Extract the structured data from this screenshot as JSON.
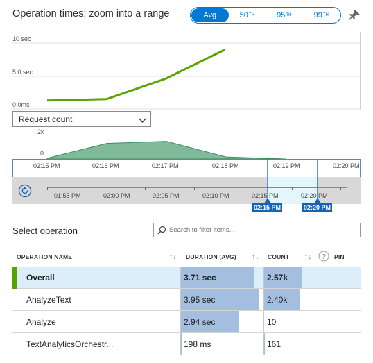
{
  "header": {
    "title": "Operation times: zoom into a range"
  },
  "percentile_toggle": {
    "options": [
      {
        "label": "Avg",
        "sup": ""
      },
      {
        "label": "50",
        "sup": "TH"
      },
      {
        "label": "95",
        "sup": "TH"
      },
      {
        "label": "99",
        "sup": "TH"
      }
    ],
    "selected": "Avg"
  },
  "duration_chart": {
    "y_ticks": [
      "10 sec",
      "5.0 sec",
      "0.0ms"
    ],
    "line_color": "#5ba300"
  },
  "metric_dropdown": {
    "value": "Request count"
  },
  "count_chart": {
    "y_ticks": [
      "2k",
      "0"
    ],
    "x_ticks": [
      "02:15 PM",
      "02:16 PM",
      "02:17 PM",
      "02:18 PM",
      "02:19 PM",
      "02:20 PM"
    ],
    "fill_color": "#7fba99"
  },
  "brush": {
    "x_ticks": [
      "01:55 PM",
      "02:00 PM",
      "02:05 PM",
      "02:10 PM",
      "02:15 PM",
      "02:20 PM"
    ],
    "handle_start": "02:15 PM",
    "handle_end": "02:20 PM"
  },
  "chart_data": [
    {
      "type": "line",
      "x": [
        "02:15 PM",
        "02:16 PM",
        "02:17 PM",
        "02:18 PM"
      ],
      "series": [
        {
          "values": [
            1.3,
            1.5,
            4.6,
            9.0
          ]
        }
      ],
      "ylim": [
        0,
        10
      ],
      "xlabel": "",
      "ylabel": ""
    },
    {
      "type": "area",
      "x": [
        "02:15 PM",
        "02:16 PM",
        "02:17 PM",
        "02:18 PM",
        "02:19 PM"
      ],
      "series": [
        {
          "values": [
            0.05,
            1.15,
            1.3,
            0.15,
            0.0
          ]
        }
      ],
      "ylim": [
        0,
        2
      ],
      "xlabel": "",
      "ylabel": ""
    }
  ],
  "select_operation": {
    "label": "Select operation",
    "search_placeholder": "Search to filter items..."
  },
  "table": {
    "headers": {
      "name": "OPERATION NAME",
      "duration": "DURATION (AVG)",
      "count": "COUNT",
      "pin": "PIN"
    },
    "rows": [
      {
        "name": "Overall",
        "duration": "3.71 sec",
        "duration_frac": 0.94,
        "count": "2.57k",
        "count_frac": 0.95,
        "selected": true
      },
      {
        "name": "AnalyzeText",
        "duration": "3.95 sec",
        "duration_frac": 1.0,
        "count": "2.40k",
        "count_frac": 0.89,
        "selected": false
      },
      {
        "name": "Analyze",
        "duration": "2.94 sec",
        "duration_frac": 0.74,
        "count": "10",
        "count_frac": 0.0,
        "selected": false
      },
      {
        "name": "TextAnalyticsOrchestr...",
        "duration": "198 ms",
        "duration_frac": 0.02,
        "count": "161",
        "count_frac": 0.02,
        "selected": false
      }
    ]
  }
}
